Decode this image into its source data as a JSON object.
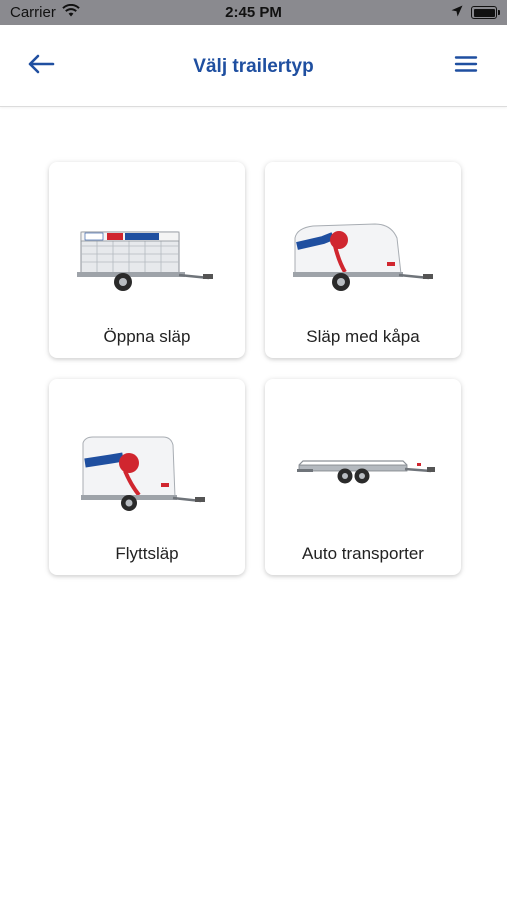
{
  "status_bar": {
    "carrier": "Carrier",
    "time": "2:45 PM"
  },
  "header": {
    "title": "Välj trailertyp",
    "back_icon": "arrow-left-icon",
    "menu_icon": "hamburger-menu-icon",
    "accent_color": "#1f4fa0"
  },
  "trailer_types": [
    {
      "label": "Öppna släp",
      "image": "open-trailer"
    },
    {
      "label": "Släp med kåpa",
      "image": "covered-trailer"
    },
    {
      "label": "Flyttsläp",
      "image": "moving-trailer"
    },
    {
      "label": "Auto transporter",
      "image": "car-transporter"
    }
  ]
}
